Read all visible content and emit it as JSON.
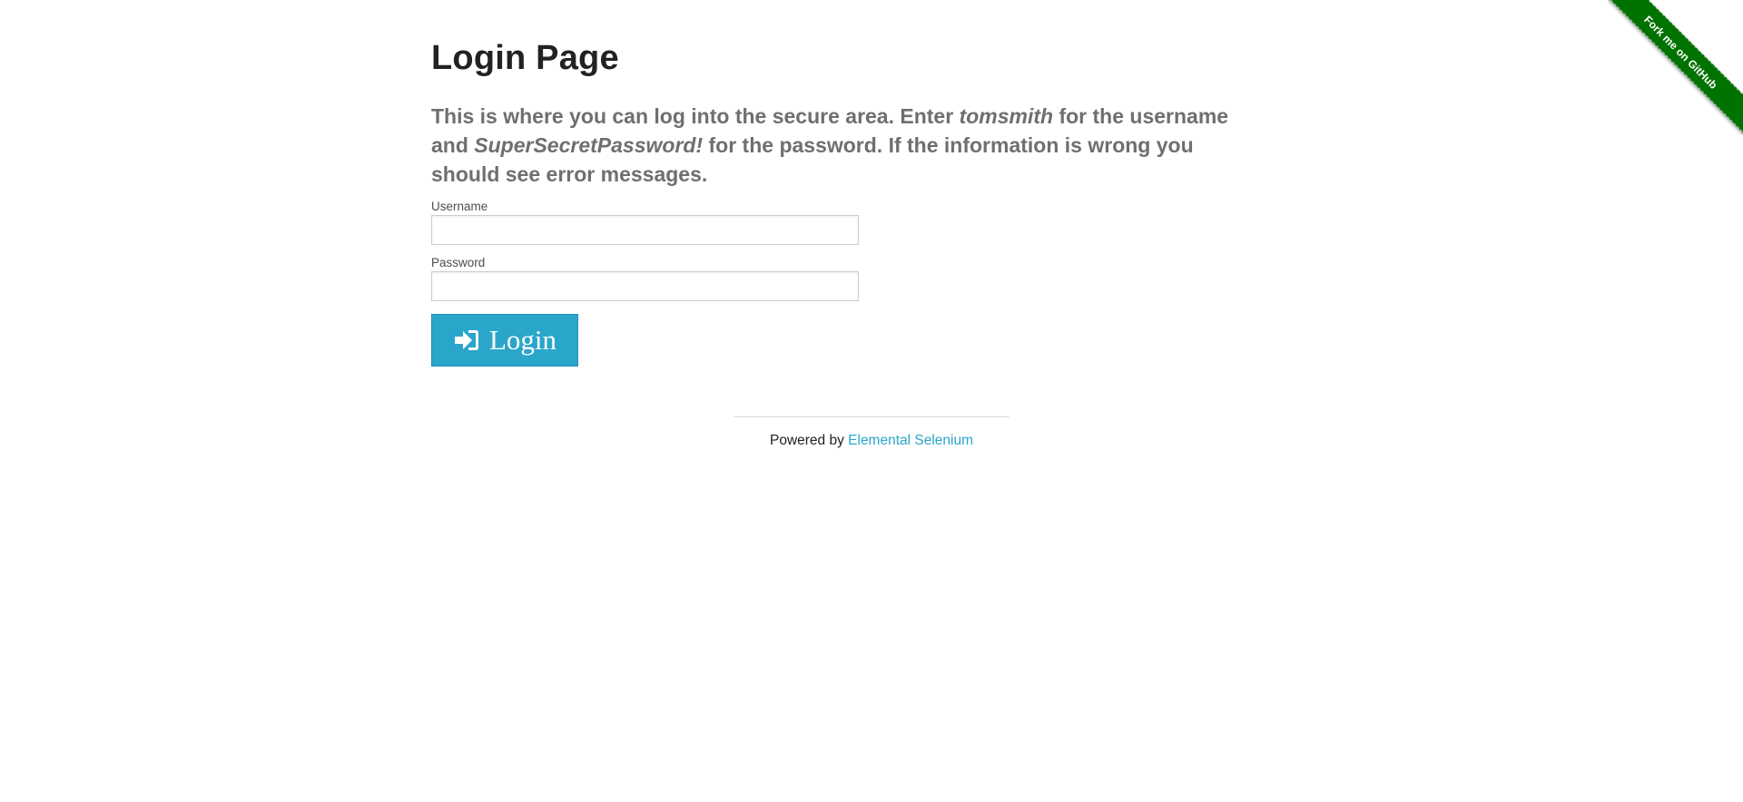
{
  "page": {
    "title": "Login Page",
    "subheader": {
      "part1": "This is where you can log into the secure area. Enter ",
      "username_hint": "tomsmith",
      "part2": " for the username and ",
      "password_hint": "SuperSecretPassword!",
      "part3": " for the password. If the information is wrong you should see error messages."
    }
  },
  "form": {
    "username_label": "Username",
    "username_value": "",
    "password_label": "Password",
    "password_value": "",
    "login_label": "Login",
    "login_icon": "sign-in-icon",
    "button_color": "#2ba6cb"
  },
  "footer": {
    "powered_by": "Powered by ",
    "link_text": "Elemental Selenium",
    "link_color": "#2ba6cb"
  },
  "ribbon": {
    "text": "Fork me on GitHub",
    "color": "#007200"
  }
}
